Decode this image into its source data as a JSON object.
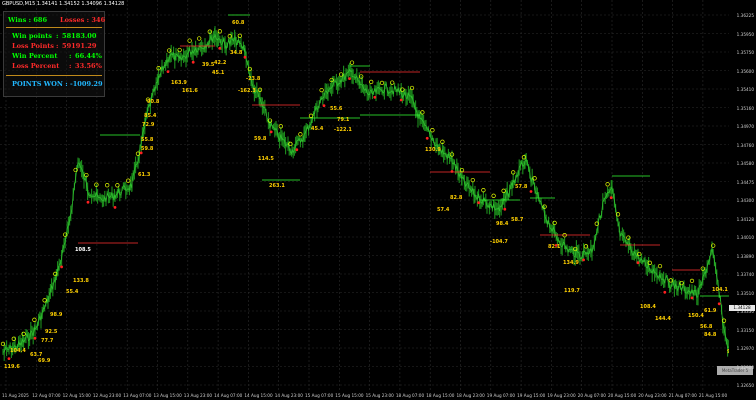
{
  "header": {
    "symbol_line": "GBPUSD,M15  1.34141 1.34152 1.34096 1.34128"
  },
  "stats": {
    "wins": "Wins : 686",
    "losses": "Losses : 346",
    "win_points_label": "Win points",
    "win_points_sep": ":",
    "win_points_value": "58183.00",
    "loss_points_label": "Loss Points",
    "loss_points_sep": ":",
    "loss_points_value": "59191.29",
    "win_percent_label": "Win Percent",
    "win_percent_sep": ":",
    "win_percent_value": "66.44%",
    "loss_percent_label": "Loss Percent",
    "loss_percent_sep": ":",
    "loss_percent_value": "33.56%",
    "points_won": "POINTS WON : -1009.29"
  },
  "price_axis": [
    "1.36225",
    "1.35950",
    "1.35750",
    "1.35600",
    "1.35410",
    "1.35160",
    "1.34970",
    "1.34760",
    "1.34580",
    "1.34475",
    "1.34300",
    "1.34128",
    "1.34010",
    "1.33890",
    "1.33740",
    "1.33510",
    "1.33330",
    "1.33150",
    "1.32970",
    "1.32800",
    "1.32650"
  ],
  "time_axis": [
    "11 Aug 2025",
    "12 Aug 07:00",
    "12 Aug 15:00",
    "12 Aug 23:00",
    "13 Aug 07:00",
    "13 Aug 15:00",
    "13 Aug 23:00",
    "14 Aug 07:00",
    "14 Aug 15:00",
    "14 Aug 23:00",
    "15 Aug 07:00",
    "15 Aug 15:00",
    "15 Aug 23:00",
    "18 Aug 07:00",
    "18 Aug 15:00",
    "18 Aug 23:00",
    "19 Aug 07:00",
    "19 Aug 15:00",
    "19 Aug 23:00",
    "20 Aug 07:00",
    "20 Aug 15:00",
    "20 Aug 23:00",
    "21 Aug 07:00",
    "21 Aug 15:00"
  ],
  "current_price": "1.34128",
  "watermark": "MetaTrader 5",
  "trade_labels": [
    {
      "t": "119.6",
      "c": "#ffd000"
    },
    {
      "t": "104.4",
      "c": "#ffd000"
    },
    {
      "t": "77.7",
      "c": "#ffd000"
    },
    {
      "t": "98.9",
      "c": "#ffd000"
    },
    {
      "t": "92.5",
      "c": "#ffd000"
    },
    {
      "t": "69.9",
      "c": "#ffd000"
    },
    {
      "t": "63.7",
      "c": "#ffd000"
    },
    {
      "t": "55.4",
      "c": "#ffd000"
    },
    {
      "t": "108.5",
      "c": "#ffffff"
    },
    {
      "t": "133.8",
      "c": "#ffd000"
    },
    {
      "t": "61.3",
      "c": "#ffd000"
    },
    {
      "t": "59.8",
      "c": "#ffd000"
    },
    {
      "t": "55.8",
      "c": "#ffd000"
    },
    {
      "t": "72.9",
      "c": "#ffd000"
    },
    {
      "t": "85.4",
      "c": "#ffd000"
    },
    {
      "t": "90.8",
      "c": "#ffd000"
    },
    {
      "t": "163.9",
      "c": "#ffd000"
    },
    {
      "t": "161.6",
      "c": "#ffd000"
    },
    {
      "t": "39.5",
      "c": "#ffd000"
    },
    {
      "t": "42.2",
      "c": "#ffd000"
    },
    {
      "t": "34.8",
      "c": "#ffd000"
    },
    {
      "t": "45.1",
      "c": "#ffd000"
    },
    {
      "t": "60.8",
      "c": "#ffd000"
    },
    {
      "t": "-162.3",
      "c": "#ffd000"
    },
    {
      "t": "-23.8",
      "c": "#ffd000"
    },
    {
      "t": "59.8",
      "c": "#ffd000"
    },
    {
      "t": "114.5",
      "c": "#ffd000"
    },
    {
      "t": "263.1",
      "c": "#ffd000"
    },
    {
      "t": "45.4",
      "c": "#ffd000"
    },
    {
      "t": "-122.1",
      "c": "#ffd000"
    },
    {
      "t": "55.6",
      "c": "#ffd000"
    },
    {
      "t": "79.1",
      "c": "#ffd000"
    },
    {
      "t": "130.9",
      "c": "#ffd000"
    },
    {
      "t": "57.4",
      "c": "#ffd000"
    },
    {
      "t": "82.8",
      "c": "#ffd000"
    },
    {
      "t": "-104.7",
      "c": "#ffd000"
    },
    {
      "t": "98.4",
      "c": "#ffd000"
    },
    {
      "t": "58.7",
      "c": "#ffd000"
    },
    {
      "t": "57.8",
      "c": "#ffd000"
    },
    {
      "t": "82.1",
      "c": "#ffd000"
    },
    {
      "t": "134.9",
      "c": "#ffd000"
    },
    {
      "t": "119.7",
      "c": "#ffd000"
    },
    {
      "t": "108.4",
      "c": "#ffd000"
    },
    {
      "t": "144.4",
      "c": "#ffd000"
    },
    {
      "t": "150.4",
      "c": "#ffd000"
    },
    {
      "t": "104.1",
      "c": "#ffd000"
    },
    {
      "t": "61.9",
      "c": "#ffd000"
    },
    {
      "t": "56.8",
      "c": "#ffd000"
    },
    {
      "t": "84.8",
      "c": "#ffd000"
    },
    {
      "t": "98.1",
      "c": "#ffd000"
    }
  ]
}
